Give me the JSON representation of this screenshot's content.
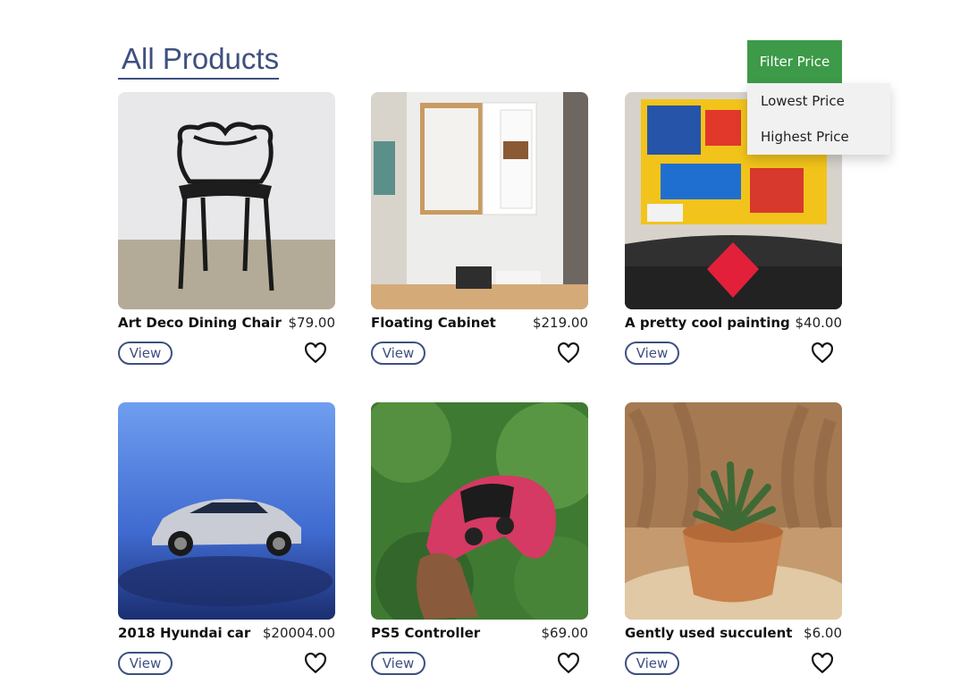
{
  "header": {
    "title": "All Products",
    "filter_label": "Filter Price",
    "filter_options": [
      "Lowest Price",
      "Highest Price"
    ]
  },
  "products": [
    {
      "name": "Art Deco Dining Chair",
      "price": "$79.00",
      "view_label": "View",
      "image": "black chair photo"
    },
    {
      "name": "Floating Cabinet",
      "price": "$219.00",
      "view_label": "View",
      "image": "wall cabinet photo"
    },
    {
      "name": "A pretty cool painting",
      "price": "$40.00",
      "view_label": "View",
      "image": "abstract painting photo"
    },
    {
      "name": "2018 Hyundai car",
      "price": "$20004.00",
      "view_label": "View",
      "image": "car photo"
    },
    {
      "name": "PS5 Controller",
      "price": "$69.00",
      "view_label": "View",
      "image": "controller photo"
    },
    {
      "name": "Gently used succulent",
      "price": "$6.00",
      "view_label": "View",
      "image": "succulent photo"
    }
  ],
  "colors": {
    "accent": "#3f5080",
    "filter_button": "#3d9a48"
  },
  "icons": {
    "favorite": "heart-outline-icon"
  }
}
